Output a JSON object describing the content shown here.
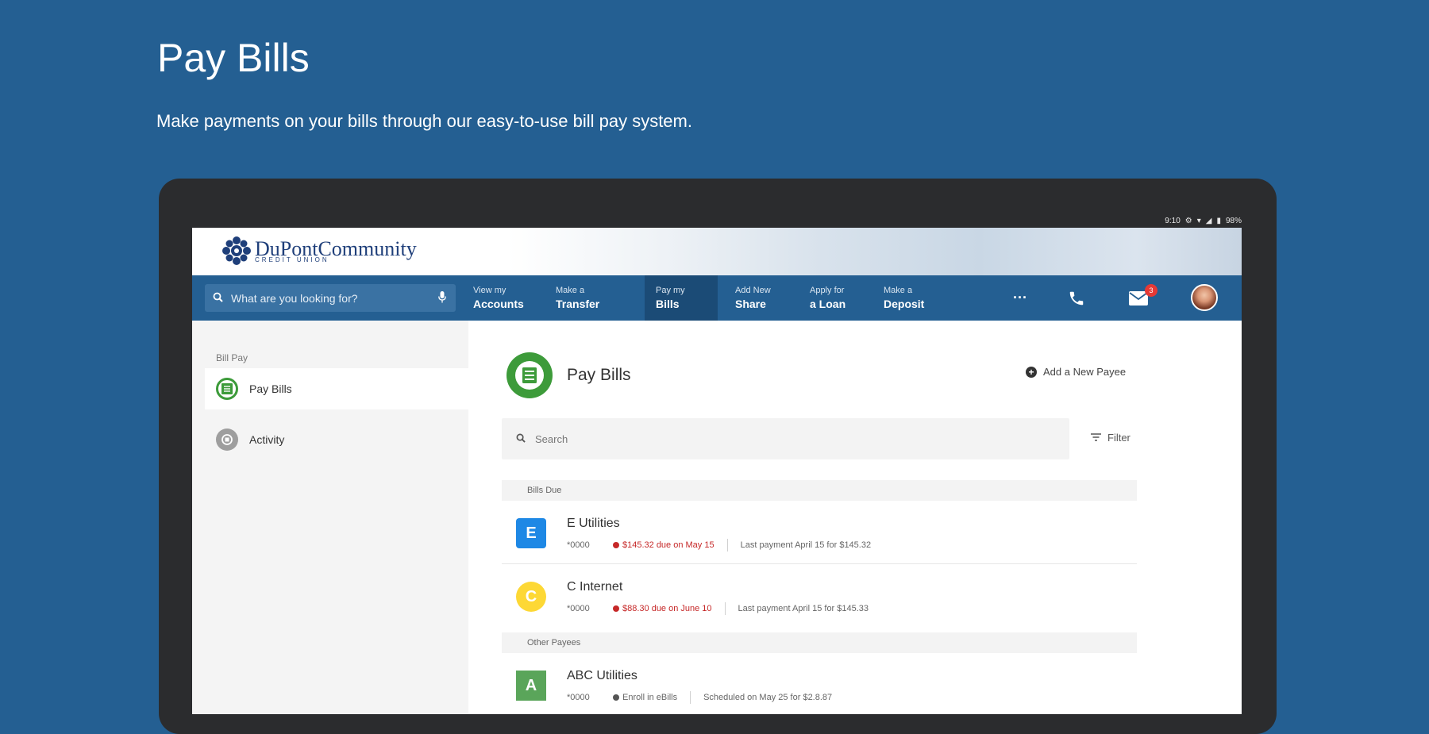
{
  "hero": {
    "title": "Pay Bills",
    "subtitle": "Make payments on your bills through our easy-to-use bill pay system."
  },
  "status_bar": {
    "time": "9:10",
    "battery": "98%"
  },
  "brand": {
    "name": "DuPontCommunity",
    "sub": "CREDIT UNION"
  },
  "nav": {
    "search_placeholder": "What are you looking for?",
    "items": [
      {
        "top": "View my",
        "bottom": "Accounts"
      },
      {
        "top": "Make a",
        "bottom": "Transfer"
      },
      {
        "top": "Pay my",
        "bottom": "Bills"
      },
      {
        "top": "Add New",
        "bottom": "Share"
      },
      {
        "top": "Apply for",
        "bottom": "a Loan"
      },
      {
        "top": "Make a",
        "bottom": "Deposit"
      }
    ],
    "more_label": "···",
    "mail_badge": "3"
  },
  "sidebar": {
    "heading": "Bill Pay",
    "items": [
      {
        "label": "Pay Bills"
      },
      {
        "label": "Activity"
      }
    ]
  },
  "main": {
    "title": "Pay Bills",
    "add_payee": "Add a New Payee",
    "search_placeholder": "Search",
    "filter": "Filter",
    "sections": [
      {
        "header": "Bills Due"
      },
      {
        "header": "Other Payees"
      }
    ],
    "bills": [
      {
        "letter": "E",
        "name": "E Utilities",
        "account": "*0000",
        "due": "$145.32 due on May 15",
        "last": "Last payment April 15 for $145.32"
      },
      {
        "letter": "C",
        "name": "C Internet",
        "account": "*0000",
        "due": "$88.30 due on June 10",
        "last": "Last payment April 15 for $145.33"
      },
      {
        "letter": "A",
        "name": "ABC Utilities",
        "account": "*0000",
        "status": "Enroll in eBills",
        "scheduled": "Scheduled on May 25 for $2.8.87"
      }
    ]
  },
  "colors": {
    "page_bg": "#245f92",
    "nav_bg": "#245f92",
    "nav_active": "#1b4b76",
    "bill_icon_green": "#3d9b3a",
    "payee_e": "#1e88e5",
    "payee_c": "#fdd835",
    "payee_a": "#5aa55a",
    "due_red": "#c62828"
  }
}
